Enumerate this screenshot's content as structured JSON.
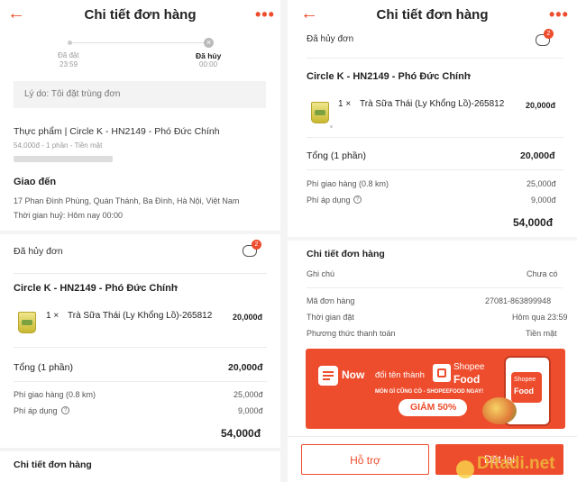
{
  "left": {
    "header": {
      "title": "Chi tiết đơn hàng"
    },
    "progress": {
      "step1_label": "Đã đặt",
      "step1_time": "23:59",
      "step2_label": "Đã hủy",
      "step2_time": "00:00"
    },
    "reason": "Lý do: Tôi đặt trùng đơn",
    "store_line": "Thực phẩm | Circle K - HN2149 - Phó Đức Chính",
    "order_summary": "54,000đ - 1 phần - Tiền mặt",
    "delivery": {
      "title": "Giao đến",
      "address": "17 Phan Đình Phùng, Quán Thánh, Ba Đình, Hà Nội, Việt Nam",
      "cancel_time": "Thời gian huỷ: Hôm nay 00:00"
    },
    "status": "Đã hủy đơn",
    "chat_badge": "2",
    "store_name": "Circle K - HN2149 - Phó Đức Chính",
    "item": {
      "qty": "1 ×",
      "name": "Trà Sữa Thái (Ly Khổng Lồ)-265812",
      "price": "20,000đ"
    },
    "subtotal_label": "Tổng (1 phần)",
    "subtotal_value": "20,000đ",
    "shipping_label": "Phí giao hàng (0.8 km)",
    "shipping_value": "25,000đ",
    "fee_label": "Phí áp dụng",
    "fee_value": "9,000đ",
    "total": "54,000đ",
    "details_title": "Chi tiết đơn hàng"
  },
  "right": {
    "header": {
      "title": "Chi tiết đơn hàng"
    },
    "status": "Đã hủy đơn",
    "chat_badge": "2",
    "store_name": "Circle K - HN2149 - Phó Đức Chính",
    "item": {
      "qty": "1 ×",
      "name": "Trà Sữa Thái (Ly Khổng Lồ)-265812",
      "price": "20,000đ"
    },
    "subtotal_label": "Tổng (1 phần)",
    "subtotal_value": "20,000đ",
    "shipping_label": "Phí giao hàng (0.8 km)",
    "shipping_value": "25,000đ",
    "fee_label": "Phí áp dụng",
    "fee_value": "9,000đ",
    "total": "54,000đ",
    "details_title": "Chi tiết đơn hàng",
    "note_label": "Ghi chú",
    "note_value": "Chưa có",
    "order_id_label": "Mã đơn hàng",
    "order_id_value": "27081-863899948",
    "order_time_label": "Thời gian đặt",
    "order_time_value": "Hôm qua 23:59",
    "payment_label": "Phương thức thanh toán",
    "payment_value": "Tiền mặt",
    "banner": {
      "now": "Now",
      "rename": "đổi tên thành",
      "brand_top": "Shopee",
      "brand_bottom": "Food",
      "tagline": "MÓN GÌ CŨNG CÓ - SHOPEEFOOD NGAY!",
      "discount": "GIẢM 50%",
      "phone_top": "Shopee",
      "phone_bottom": "Food"
    },
    "support_button": "Hỗ trợ",
    "reorder_button": "Đặt lại",
    "watermark": "Ditadi.net"
  },
  "colors": {
    "accent": "#ee4d2d",
    "gray_text": "#555555",
    "divider": "#ececec"
  }
}
